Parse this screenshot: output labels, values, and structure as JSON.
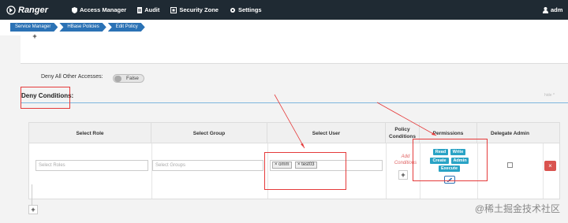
{
  "navbar": {
    "brand": "Ranger",
    "items": [
      {
        "label": "Access Manager",
        "icon": "shield-icon"
      },
      {
        "label": "Audit",
        "icon": "file-icon"
      },
      {
        "label": "Security Zone",
        "icon": "zone-icon"
      },
      {
        "label": "Settings",
        "icon": "gear-icon"
      }
    ],
    "user": "adm"
  },
  "breadcrumb": [
    "Service Manager",
    "HBase Policies",
    "Edit Policy"
  ],
  "deny_all": {
    "label": "Deny All Other Accesses:",
    "value": "False"
  },
  "deny_conditions": {
    "title": "Deny Conditions:",
    "hide_label": "hide ^",
    "columns": [
      "Select Role",
      "Select Group",
      "Select User",
      "Policy Conditions",
      "Permissions",
      "Delegate Admin"
    ],
    "row": {
      "role_placeholder": "Select Roles",
      "group_placeholder": "Select Groups",
      "users": [
        "omm",
        "test03"
      ],
      "add_conditions": "Add Conditions",
      "permissions": [
        "Read",
        "Write",
        "Create",
        "Admin",
        "Execute"
      ],
      "delegate_admin": false,
      "delete_label": "×"
    }
  },
  "colors": {
    "navbar": "#1f2a33",
    "breadcrumb": "#2b72b5",
    "permission": "#2aa3c5",
    "delete": "#d9534f",
    "annotation": "#e53a3a"
  },
  "watermark": "@稀土掘金技术社区"
}
